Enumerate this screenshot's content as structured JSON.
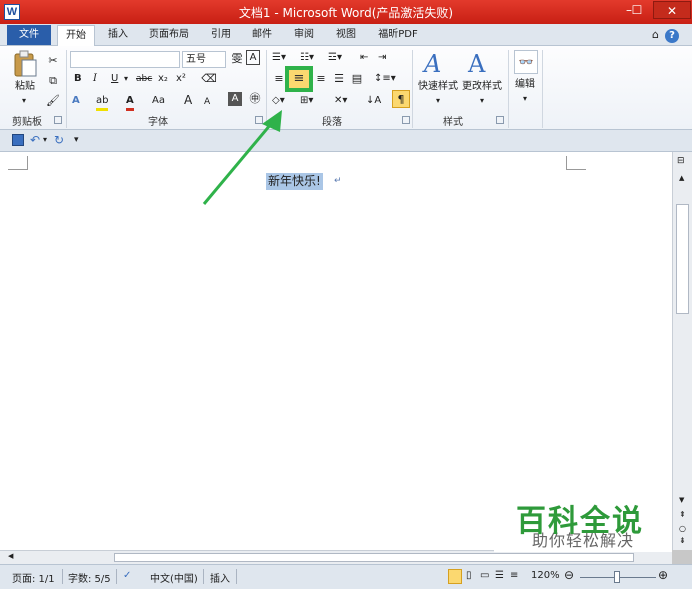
{
  "window": {
    "title": "文档1 - Microsoft Word(产品激活失败)",
    "app_icon_letter": "W",
    "min_glyph": "–",
    "max_glyph": "☐",
    "close_glyph": "✕"
  },
  "tabs": {
    "file": "文件",
    "items": [
      "开始",
      "插入",
      "页面布局",
      "引用",
      "邮件",
      "审阅",
      "视图",
      "福昕PDF"
    ],
    "active_index": 0,
    "collapse_glyph": "⌂",
    "help_glyph": "?"
  },
  "ribbon": {
    "clipboard": {
      "label": "剪贴板",
      "paste_label": "粘贴"
    },
    "font": {
      "label": "字体",
      "font_size": "五号",
      "wen_glyph": "雯",
      "a_box": "A"
    },
    "paragraph": {
      "label": "段落"
    },
    "styles": {
      "label": "样式",
      "quick_styles": "快速样式",
      "change_styles": "更改样式"
    },
    "editing": {
      "label": "编辑"
    }
  },
  "document": {
    "selected_text": "新年快乐!"
  },
  "statusbar": {
    "page": "页面: 1/1",
    "words": "字数: 5/5",
    "language": "中文(中国)",
    "mode": "插入",
    "zoom": "120%"
  },
  "watermark": {
    "main": "百科全说",
    "sub": "助你轻松解决"
  },
  "colors": {
    "title_red": "#d42a1f",
    "file_blue": "#2a5eaa",
    "highlight_green": "#2fb24a",
    "selection": "#aac6e6"
  }
}
